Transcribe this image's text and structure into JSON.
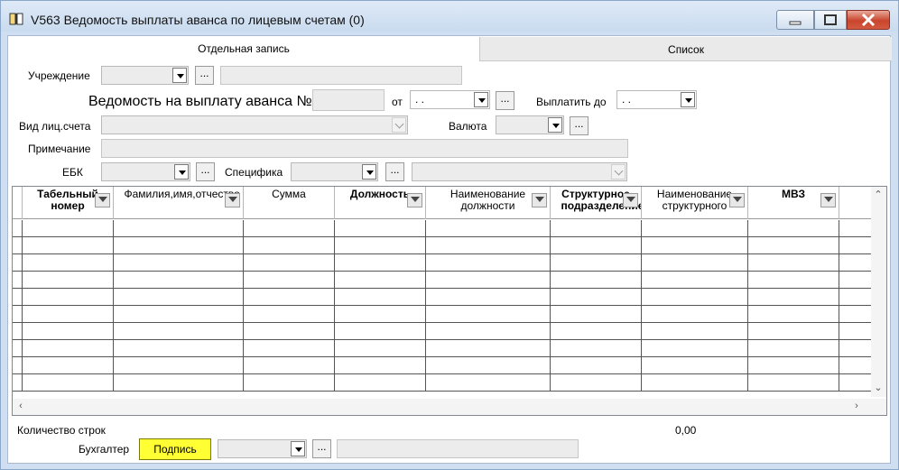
{
  "window": {
    "title": "V563 Ведомость выплаты аванса по лицевым счетам (0)"
  },
  "tabs": [
    {
      "label": "Отдельная запись"
    },
    {
      "label": "Список"
    }
  ],
  "form": {
    "institution_label": "Учреждение",
    "statement_title": "Ведомость на выплату аванса №",
    "from_label": "от",
    "from_date": ". .",
    "pay_until_label": "Выплатить до",
    "pay_until_date": ". .",
    "account_type_label": "Вид лиц.счета",
    "currency_label": "Валюта",
    "note_label": "Примечание",
    "ebk_label": "ЕБК",
    "spec_label": "Специфика"
  },
  "ellipsis": "...",
  "table": {
    "columns": [
      {
        "label": "Табельный номер",
        "bold": true
      },
      {
        "label": "Фамилия,имя,отчество",
        "bold": false
      },
      {
        "label": "Сумма",
        "bold": false
      },
      {
        "label": "Должность",
        "bold": true
      },
      {
        "label": "Наименование должности",
        "bold": false
      },
      {
        "label": "Структурное подразделение",
        "bold": true
      },
      {
        "label": "Наименование структурного",
        "bold": false
      },
      {
        "label": "МВЗ",
        "bold": true
      }
    ],
    "row_count": 10
  },
  "footer": {
    "rows_count_label": "Количество строк",
    "total": "0,00",
    "accountant_label": "Бухгалтер",
    "sign_button": "Подпись"
  },
  "colors": {
    "sign_button": "#ffff33",
    "window_bg": "#cfdff1"
  },
  "icons": [
    "app-book-icon",
    "minimize-icon",
    "maximize-icon",
    "close-icon",
    "filter-icon",
    "chevron-down-icon"
  ]
}
